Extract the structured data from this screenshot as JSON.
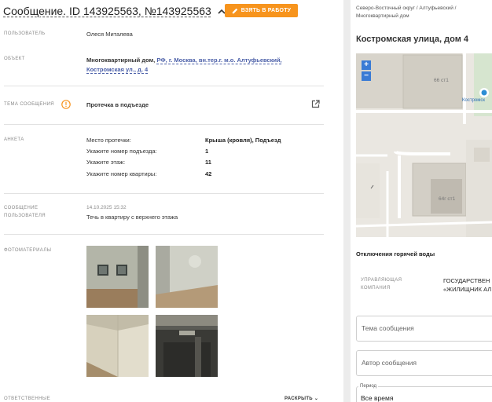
{
  "header": {
    "title_prefix": "Сообщение. ID 143925563, №143925563",
    "take_button": "ВЗЯТЬ В РАБОТУ"
  },
  "fields": {
    "user_label": "ПОЛЬЗОВАТЕЛЬ",
    "user_value": "Олеся Миталева",
    "object_label": "ОБЪЕКТ",
    "object_type": "Многоквартирный дом,",
    "object_address": "РФ, г. Москва, вн.тер.г. м.о. Алтуфьевский, Костромская ул., д. 4",
    "topic_label": "ТЕМА СООБЩЕНИЯ",
    "topic_value": "Протечка в подъезде",
    "anketa_label": "АНКЕТА",
    "anketa": [
      {
        "q": "Место протечки:",
        "a": "Крыша (кровля), Подъезд"
      },
      {
        "q": "Укажите номер подъезда:",
        "a": "1"
      },
      {
        "q": "Укажите этаж:",
        "a": "11"
      },
      {
        "q": "Укажите номер квартиры:",
        "a": "42"
      }
    ],
    "user_msg_label_1": "СООБЩЕНИЕ",
    "user_msg_label_2": "ПОЛЬЗОВАТЕЛЯ",
    "user_msg_date": "14.10.2025 15:32",
    "user_msg_text": "Течь в квартиру с верхнего этажа",
    "photos_label": "ФОТОМАТЕРИАЛЫ",
    "responsible_label": "ОТВЕТСТВЕННЫЕ",
    "expand_label": "РАСКРЫТЬ"
  },
  "right": {
    "breadcrumb": "Северо-Восточный округ / Алтуфьевский / Многоквартирный дом",
    "title": "Костромская улица, дом 4",
    "map": {
      "zoom_in": "+",
      "zoom_out": "−",
      "building_1": "66 ст1",
      "building_2": "64г ст1",
      "street": "Костромск"
    },
    "hot_water": "Отключения горячей воды",
    "uk_label_1": "УПРАВЛЯЮЩАЯ",
    "uk_label_2": "КОМПАНИЯ",
    "uk_value_1": "ГОСУДАРСТВЕН",
    "uk_value_2": "«ЖИЛИЩНИК АЛ",
    "topic_placeholder": "Тема сообщения",
    "author_placeholder": "Автор сообщения",
    "period_label": "Период",
    "period_value": "Все время"
  },
  "colors": {
    "accent": "#f7941d",
    "link": "#4b5fa8"
  }
}
